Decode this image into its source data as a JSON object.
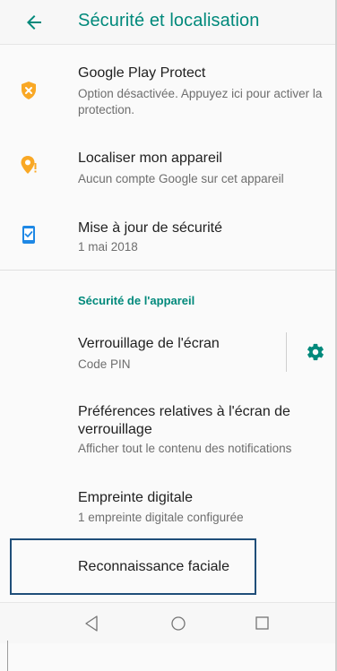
{
  "appbar": {
    "title": "Sécurité et localisation",
    "back_icon": "arrow-back-icon"
  },
  "items": [
    {
      "title": "Google Play Protect",
      "subtitle": "Option désactivée. Appuyez ici pour activer la protection.",
      "icon": "shield-warning-icon",
      "icon_color": "#f9a825"
    },
    {
      "title": "Localiser mon appareil",
      "subtitle": "Aucun compte Google sur cet appareil",
      "icon": "location-warning-icon",
      "icon_color": "#f9a825"
    },
    {
      "title": "Mise à jour de sécurité",
      "subtitle": "1 mai 2018",
      "icon": "phone-check-icon",
      "icon_color": "#1e88e5"
    }
  ],
  "section": {
    "label": "Sécurité de l'appareil"
  },
  "device_items": [
    {
      "title": "Verrouillage de l'écran",
      "subtitle": "Code PIN",
      "action_icon": "gear-icon"
    },
    {
      "title": "Préférences relatives à l'écran de verrouillage",
      "subtitle": "Afficher tout le contenu des notifications"
    },
    {
      "title": "Empreinte digitale",
      "subtitle": "1 empreinte digitale configurée"
    },
    {
      "title": "Reconnaissance faciale"
    }
  ],
  "navbar": {
    "back": "nav-back-icon",
    "home": "nav-home-icon",
    "recents": "nav-recents-icon"
  },
  "colors": {
    "accent": "#00897b",
    "warning": "#f9a825",
    "info": "#1e88e5",
    "highlight_border": "#1f4e79"
  }
}
